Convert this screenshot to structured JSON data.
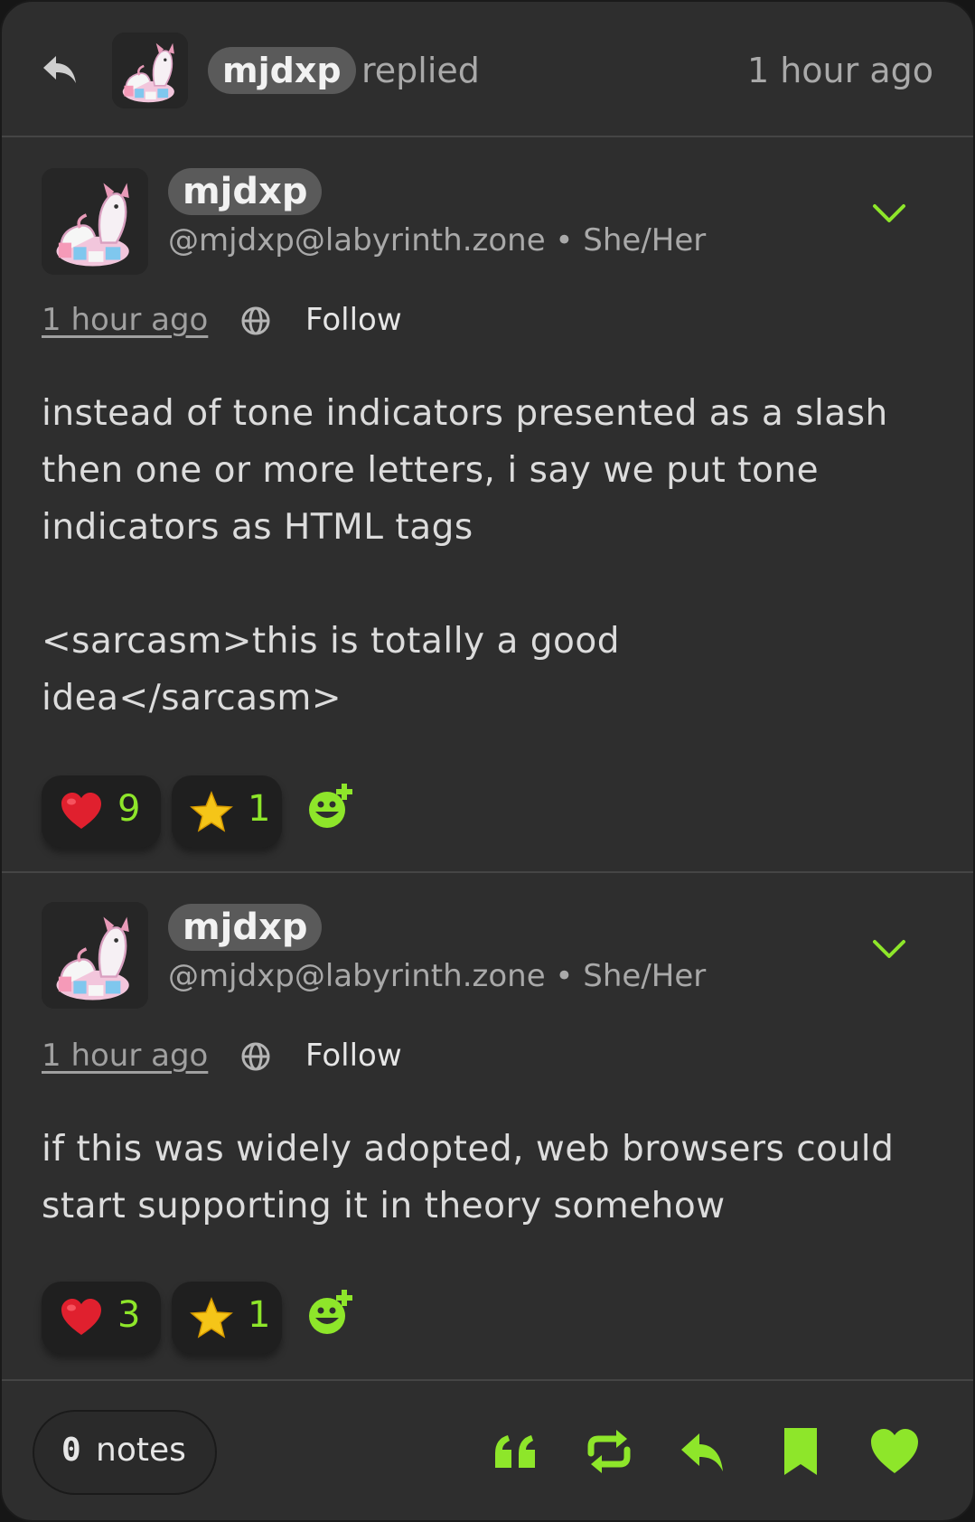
{
  "header": {
    "username": "mjdxp",
    "action": "replied",
    "time": "1 hour ago"
  },
  "posts": [
    {
      "username": "mjdxp",
      "handle": "@mjdxp@labyrinth.zone • She/Her",
      "time": "1 hour ago",
      "follow": "Follow",
      "content": "instead of tone indicators presented as a slash\nthen one or more letters, i say we put tone\nindicators as HTML tags\n\n<sarcasm>this is totally a good\nidea</sarcasm>",
      "reactions": [
        {
          "icon": "red-heart-emoji",
          "count": "9"
        },
        {
          "icon": "star-emoji",
          "count": "1"
        }
      ]
    },
    {
      "username": "mjdxp",
      "handle": "@mjdxp@labyrinth.zone • She/Her",
      "time": "1 hour ago",
      "follow": "Follow",
      "content": "if this was widely adopted, web browsers could\nstart supporting it in theory somehow",
      "reactions": [
        {
          "icon": "red-heart-emoji",
          "count": "3"
        },
        {
          "icon": "star-emoji",
          "count": "1"
        }
      ]
    }
  ],
  "footer": {
    "notes_count": "0",
    "notes_label": "notes",
    "actions": [
      "quote-icon",
      "repost-icon",
      "reply-icon",
      "bookmark-icon",
      "like-icon"
    ]
  },
  "colors": {
    "accent": "#8ee62a",
    "card_bg": "#2e2e2e",
    "pill_bg": "#5a5a5a",
    "heart": "#e0202e",
    "star": "#f5c518"
  }
}
